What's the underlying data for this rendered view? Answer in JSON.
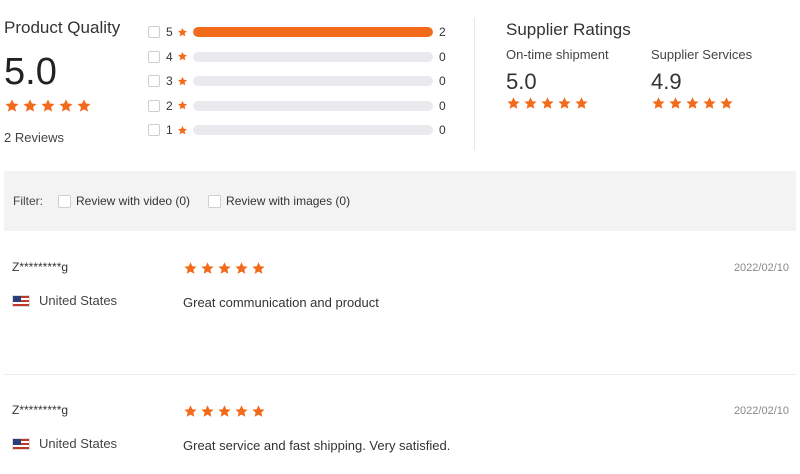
{
  "product_quality": {
    "title": "Product Quality",
    "score": "5.0",
    "stars": 5,
    "reviews_text": "2 Reviews"
  },
  "distribution": [
    {
      "stars": "5",
      "count": "2",
      "fraction": 1.0
    },
    {
      "stars": "4",
      "count": "0",
      "fraction": 0
    },
    {
      "stars": "3",
      "count": "0",
      "fraction": 0
    },
    {
      "stars": "2",
      "count": "0",
      "fraction": 0
    },
    {
      "stars": "1",
      "count": "0",
      "fraction": 0
    }
  ],
  "supplier_ratings": {
    "title": "Supplier Ratings",
    "ontime": {
      "label": "On-time shipment",
      "score": "5.0",
      "stars": 5
    },
    "services": {
      "label": "Supplier Services",
      "score": "4.9",
      "stars": 5
    }
  },
  "filter": {
    "label": "Filter:",
    "options": [
      {
        "label": "Review with video (0)",
        "checked": false
      },
      {
        "label": "Review with images (0)",
        "checked": false
      }
    ]
  },
  "reviews": [
    {
      "name": "Z*********g",
      "country": "United States",
      "stars": 5,
      "text": "Great communication and product",
      "date": "2022/02/10"
    },
    {
      "name": "Z*********g",
      "country": "United States",
      "stars": 5,
      "text": "Great service and fast shipping. Very satisfied.",
      "date": "2022/02/10"
    }
  ],
  "colors": {
    "accent": "#f26b1d",
    "track": "#e9e9ee",
    "filter_bg": "#f3f3f3"
  },
  "icons": {
    "star": "star-icon",
    "flag": "us-flag-icon"
  }
}
